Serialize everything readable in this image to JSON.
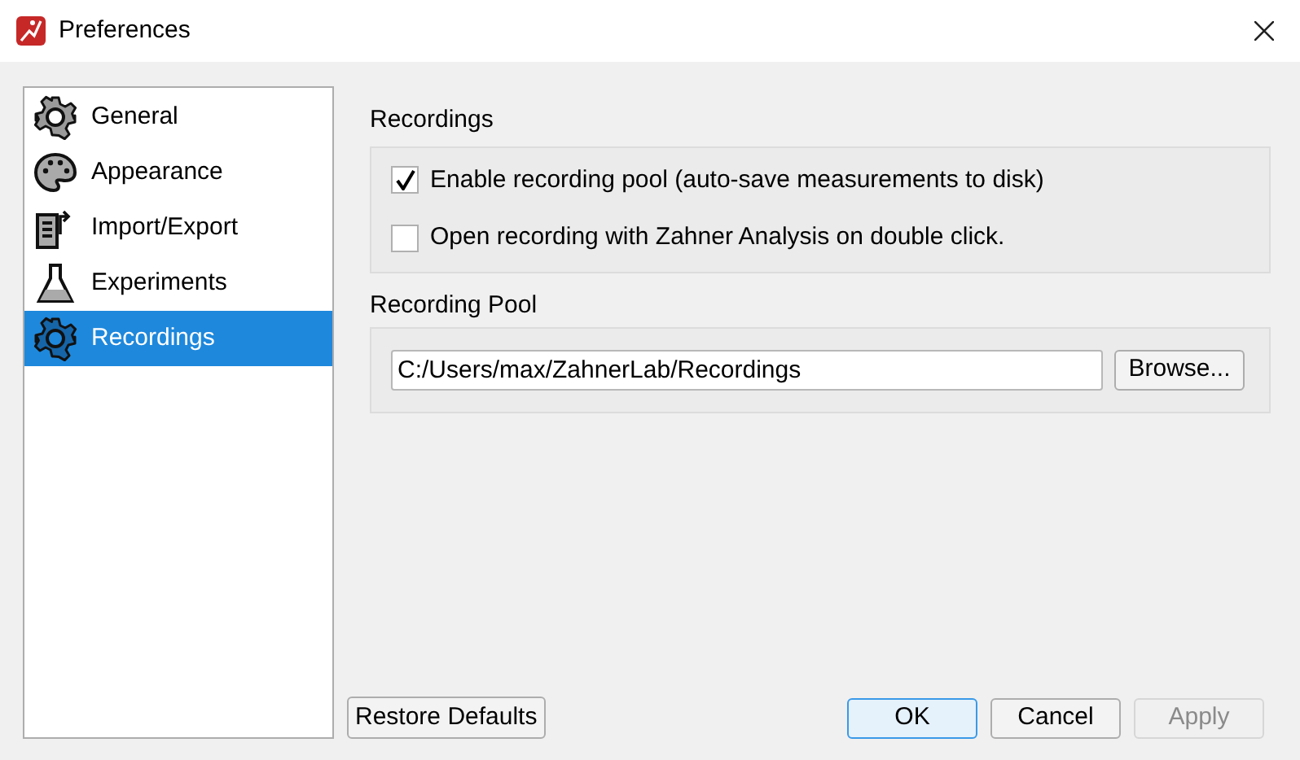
{
  "window": {
    "title": "Preferences"
  },
  "sidebar": {
    "items": [
      {
        "label": "General",
        "kind": "gear",
        "selected": false
      },
      {
        "label": "Appearance",
        "kind": "palette",
        "selected": false
      },
      {
        "label": "Import/Export",
        "kind": "export",
        "selected": false
      },
      {
        "label": "Experiments",
        "kind": "flask",
        "selected": false
      },
      {
        "label": "Recordings",
        "kind": "gear",
        "selected": true
      }
    ]
  },
  "recordings": {
    "title": "Recordings",
    "options": [
      {
        "label": "Enable recording pool (auto-save measurements to disk)",
        "checked": true
      },
      {
        "label": "Open recording with Zahner Analysis on double click.",
        "checked": false
      }
    ]
  },
  "recording_pool": {
    "title": "Recording Pool",
    "path": "C:/Users/max/ZahnerLab/Recordings",
    "browse": "Browse..."
  },
  "footer": {
    "restore": "Restore Defaults",
    "buttons": [
      {
        "label": "OK",
        "default": true,
        "disabled": false
      },
      {
        "label": "Cancel",
        "default": false,
        "disabled": false
      },
      {
        "label": "Apply",
        "default": false,
        "disabled": true
      }
    ]
  }
}
